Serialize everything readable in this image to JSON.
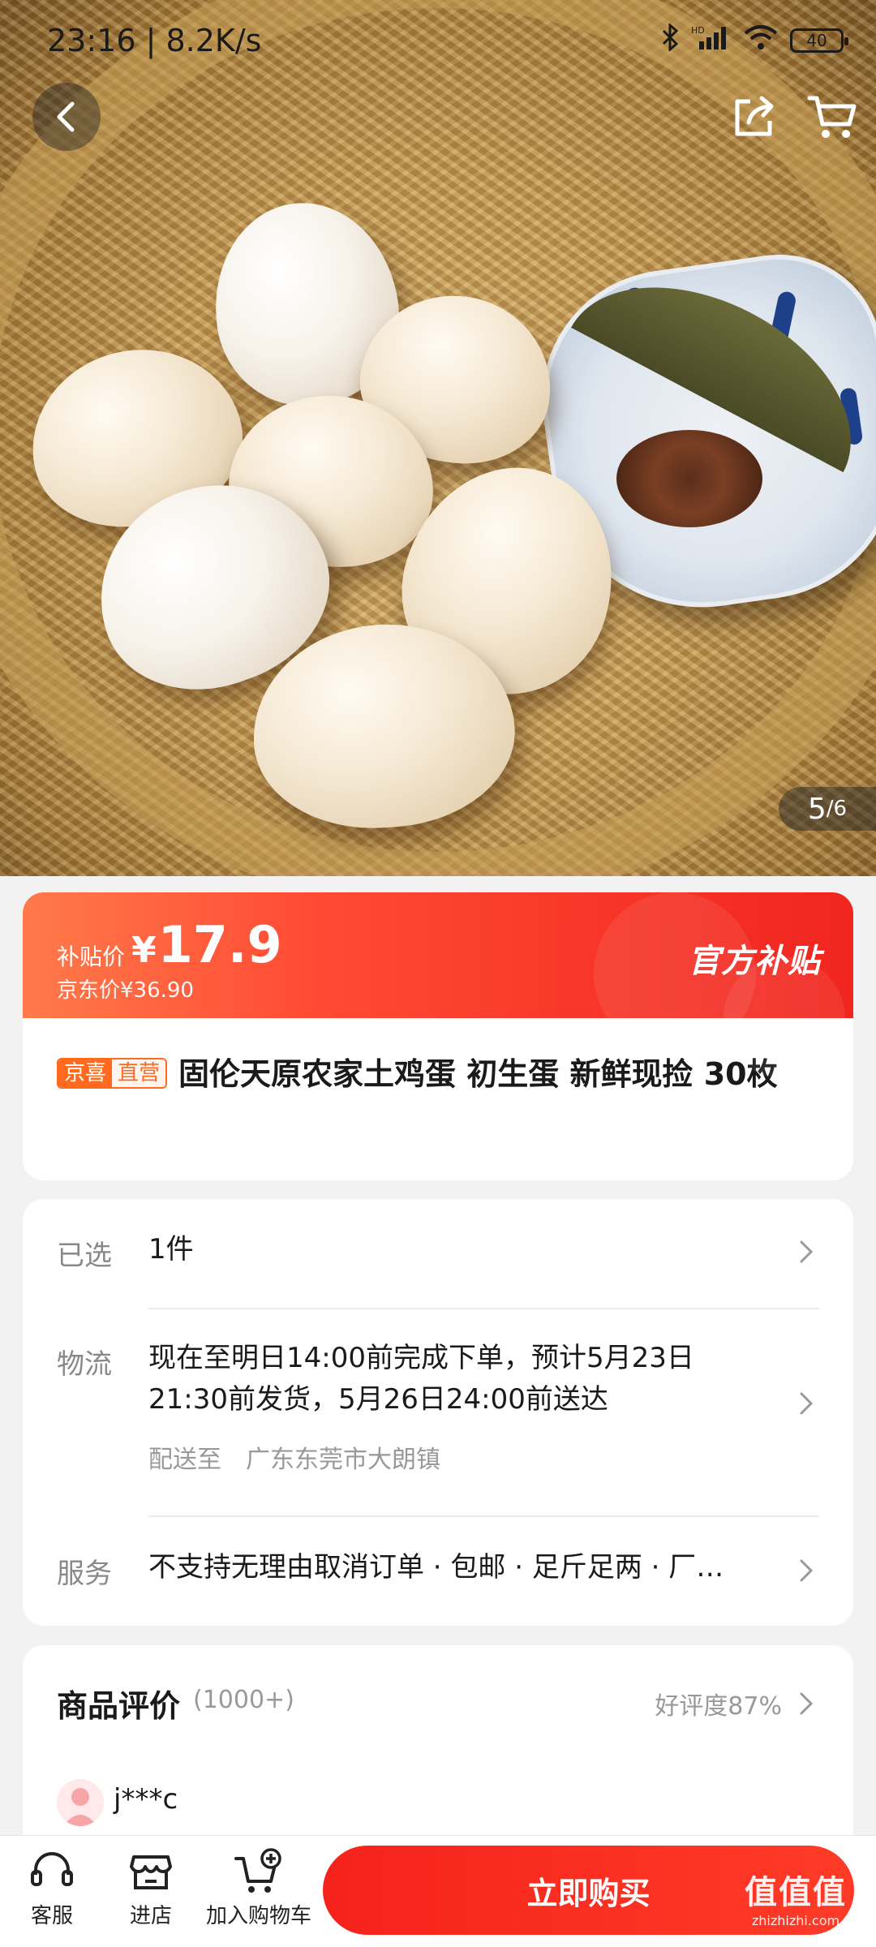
{
  "status_bar": {
    "time_speed": "23:16 | 8.2K/s",
    "battery": "40",
    "network": "HD"
  },
  "gallery": {
    "current": "5",
    "total": "/6"
  },
  "price": {
    "subsidy_label": "补贴价",
    "currency": "¥",
    "subsidy_price": "17.9",
    "original_label_price": "京东价¥36.90",
    "badge": "官方补贴"
  },
  "product": {
    "tag_primary": "京喜",
    "tag_secondary": "直营",
    "title": "固伦天原农家土鸡蛋 初生蛋  新鲜现捡 30枚"
  },
  "selection": {
    "label": "已选",
    "value": "1件"
  },
  "logistics": {
    "label": "物流",
    "line1": "现在至明日14:00前完成下单，预计5月23日",
    "line2": "21:30前发货，5月26日24:00前送达",
    "ship_to_label": "配送至",
    "ship_to": "广东东莞市大朗镇"
  },
  "service": {
    "label": "服务",
    "value": "不支持无理由取消订单 · 包邮 · 足斤足两 · 厂…"
  },
  "reviews": {
    "title": "商品评价",
    "count": "(1000+)",
    "rating": "好评度87%",
    "first_reviewer": "j***c"
  },
  "bottom_bar": {
    "service": "客服",
    "store": "进店",
    "add_cart": "加入购物车",
    "buy_now": "立即购买"
  },
  "watermark": {
    "brand": "值值值",
    "site": "zhizhizhi.com"
  }
}
